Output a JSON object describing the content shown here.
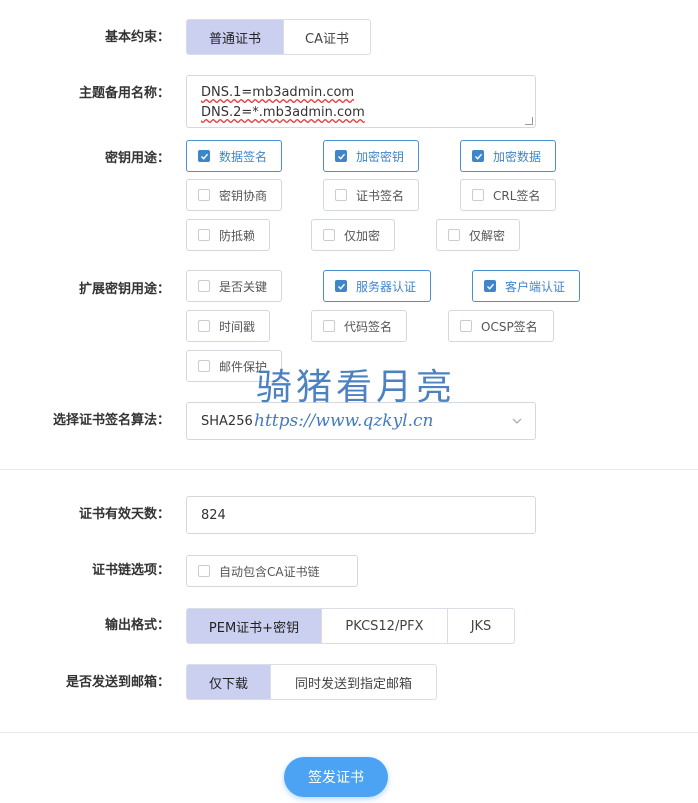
{
  "basic_constraint": {
    "label": "基本约束：",
    "options": [
      "普通证书",
      "CA证书"
    ],
    "selected": "普通证书"
  },
  "san": {
    "label": "主题备用名称：",
    "lines": [
      "DNS.1=mb3admin.com",
      "DNS.2=*.mb3admin.com"
    ]
  },
  "key_usage": {
    "label": "密钥用途：",
    "items": [
      {
        "label": "数据签名",
        "checked": true
      },
      {
        "label": "加密密钥",
        "checked": true
      },
      {
        "label": "加密数据",
        "checked": true
      },
      {
        "label": "密钥协商",
        "checked": false
      },
      {
        "label": "证书签名",
        "checked": false
      },
      {
        "label": "CRL签名",
        "checked": false
      },
      {
        "label": "防抵赖",
        "checked": false
      },
      {
        "label": "仅加密",
        "checked": false
      },
      {
        "label": "仅解密",
        "checked": false
      }
    ]
  },
  "ext_key_usage": {
    "label": "扩展密钥用途：",
    "items": [
      {
        "label": "是否关键",
        "checked": false
      },
      {
        "label": "服务器认证",
        "checked": true
      },
      {
        "label": "客户端认证",
        "checked": true
      },
      {
        "label": "时间戳",
        "checked": false
      },
      {
        "label": "代码签名",
        "checked": false
      },
      {
        "label": "OCSP签名",
        "checked": false
      },
      {
        "label": "邮件保护",
        "checked": false
      }
    ]
  },
  "sig_algorithm": {
    "label": "选择证书签名算法：",
    "value": "SHA256"
  },
  "validity": {
    "label": "证书有效天数：",
    "value": "824"
  },
  "chain": {
    "label": "证书链选项：",
    "option": {
      "label": "自动包含CA证书链",
      "checked": false
    }
  },
  "output_format": {
    "label": "输出格式：",
    "options": [
      "PEM证书+密钥",
      "PKCS12/PFX",
      "JKS"
    ],
    "selected": "PEM证书+密钥"
  },
  "email": {
    "label": "是否发送到邮箱：",
    "options": [
      "仅下载",
      "同时发送到指定邮箱"
    ],
    "selected": "仅下载"
  },
  "submit_label": "签发证书",
  "watermark": {
    "title": "骑猪看月亮",
    "url": "https://www.qzkyl.cn"
  },
  "colors": {
    "accent": "#3f86c9",
    "selected_segment": "#ccd0f0",
    "submit_button": "#4da3f3"
  }
}
